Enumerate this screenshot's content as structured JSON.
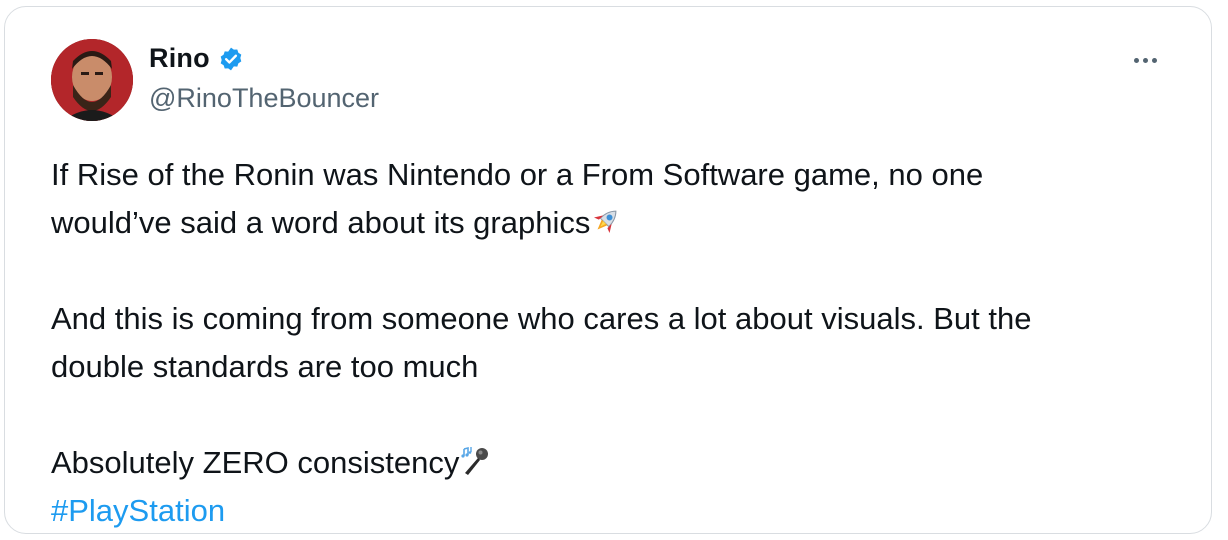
{
  "author": {
    "display_name": "Rino",
    "handle": "@RinoTheBouncer",
    "verified": true,
    "avatar_icon": "user-avatar-icon"
  },
  "tweet": {
    "paragraphs": [
      {
        "lines": [
          "If Rise of the Ronin was Nintendo or a From Software game, no one",
          "would’ve said a word about its graphics"
        ],
        "emoji": "rocket-emoji-icon"
      },
      {
        "lines": [
          "And this is coming from someone who cares a lot about visuals. But the",
          "double standards are too much"
        ]
      },
      {
        "lines": [
          "Absolutely ZERO consistency"
        ],
        "emoji": "microphone-emoji-icon"
      }
    ],
    "hashtag": "#PlayStation"
  },
  "menu": {
    "icon": "more-options-icon"
  },
  "colors": {
    "text": "#0f1419",
    "secondary_text": "#536471",
    "link": "#1d9bf0",
    "verified_badge": "#1d9bf0",
    "border": "#d9dde1"
  }
}
